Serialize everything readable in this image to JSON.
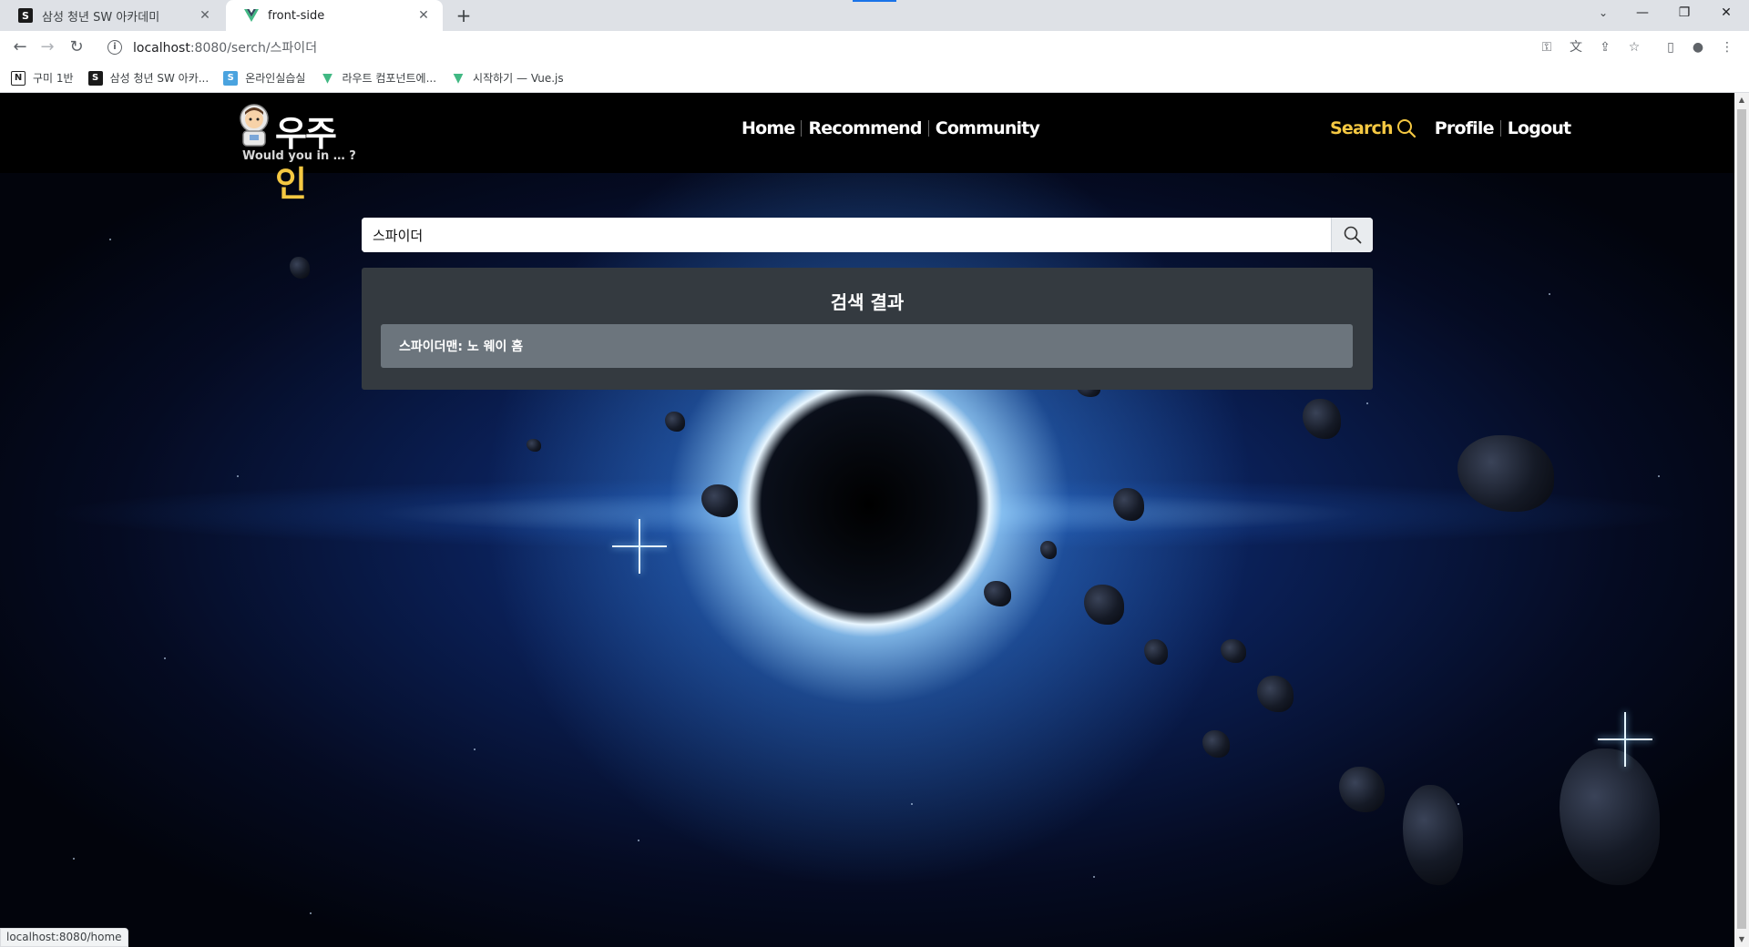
{
  "browser": {
    "tabs": [
      {
        "title": "삼성 청년 SW 아카데미",
        "favicon": "samsung-s"
      },
      {
        "title": "front-side",
        "favicon": "vue-logo"
      }
    ],
    "new_tab": "+",
    "address": {
      "host": "localhost",
      "path": ":8080/serch/스파이더"
    },
    "info_icon": "i",
    "bookmarks": [
      {
        "label": "구미 1반",
        "icon": "notion-icon"
      },
      {
        "label": "삼성 청년 SW 아카...",
        "icon": "samsung-icon"
      },
      {
        "label": "온라인실습실",
        "icon": "online-icon"
      },
      {
        "label": "라우트 컴포넌트에...",
        "icon": "vue-icon"
      },
      {
        "label": "시작하기 — Vue.js",
        "icon": "vue-icon"
      }
    ],
    "status_url": "localhost:8080/home"
  },
  "site": {
    "logo_text_1": "우주",
    "logo_text_2": "인",
    "logo_sub": "Would you in … ?",
    "nav": [
      "Home",
      "Recommend",
      "Community"
    ],
    "search_link": "Search",
    "profile": "Profile",
    "logout": "Logout"
  },
  "search": {
    "value": "스파이더"
  },
  "results": {
    "title": "검색 결과",
    "items": [
      "스파이더맨: 노 웨이 홈"
    ]
  },
  "colors": {
    "accent": "#f5c842",
    "nav_bg": "#000000",
    "results_bg": "#343a40",
    "row_bg": "#6c757d"
  }
}
